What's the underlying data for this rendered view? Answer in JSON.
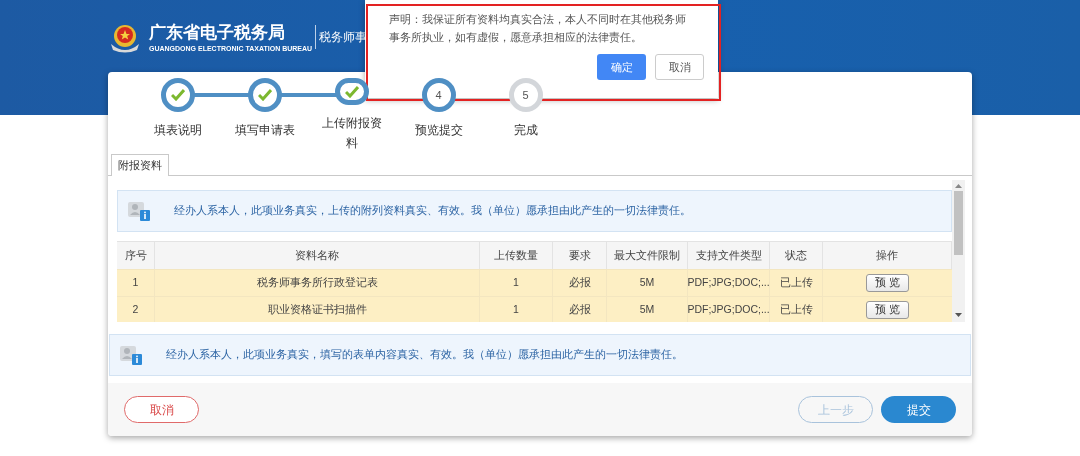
{
  "header": {
    "title": "广东省电子税务局",
    "subtitle": "GUANGDONG ELECTRONIC TAXATION BUREAU",
    "section_title": "税务师事"
  },
  "dialog": {
    "text": "声明：我保证所有资料均真实合法，本人不同时在其他税务师事务所执业，如有虚假，愿意承担相应的法律责任。",
    "buttons": [
      {
        "label": "确定",
        "kind": "primary"
      },
      {
        "label": "取消",
        "kind": "secondary"
      }
    ]
  },
  "steps": [
    {
      "label": "填表说明",
      "kind": "done"
    },
    {
      "label": "填写申请表",
      "kind": "done"
    },
    {
      "label": "上传附报资料",
      "kind": "done"
    },
    {
      "label": "预览提交",
      "kind": "current",
      "number": "4"
    },
    {
      "label": "完成",
      "kind": "todo",
      "number": "5"
    }
  ],
  "tabs": [
    {
      "label": "附报资料",
      "selected": true
    }
  ],
  "notices": [
    "经办人系本人，此项业务真实，上传的附列资料真实、有效。我（单位）愿承担由此产生的一切法律责任。",
    "经办人系本人，此项业务真实，填写的表单内容真实、有效。我（单位）愿承担由此产生的一切法律责任。"
  ],
  "table": {
    "columns": [
      "序号",
      "资料名称",
      "上传数量",
      "要求",
      "最大文件限制",
      "支持文件类型",
      "状态",
      "操作"
    ],
    "rows": [
      {
        "cells": [
          "1",
          "税务师事务所行政登记表",
          "1",
          "必报",
          "5M",
          "PDF;JPG;DOC;...",
          "已上传"
        ],
        "action": "预 览"
      },
      {
        "cells": [
          "2",
          "职业资格证书扫描件",
          "1",
          "必报",
          "5M",
          "PDF;JPG;DOC;...",
          "已上传"
        ],
        "action": "预 览"
      }
    ]
  },
  "footer": {
    "buttons": [
      {
        "label": "取消",
        "kind": "danger",
        "disabled": false
      },
      {
        "label": "上一步",
        "kind": "default",
        "disabled": true
      },
      {
        "label": "提交",
        "kind": "primary",
        "disabled": false
      }
    ]
  }
}
